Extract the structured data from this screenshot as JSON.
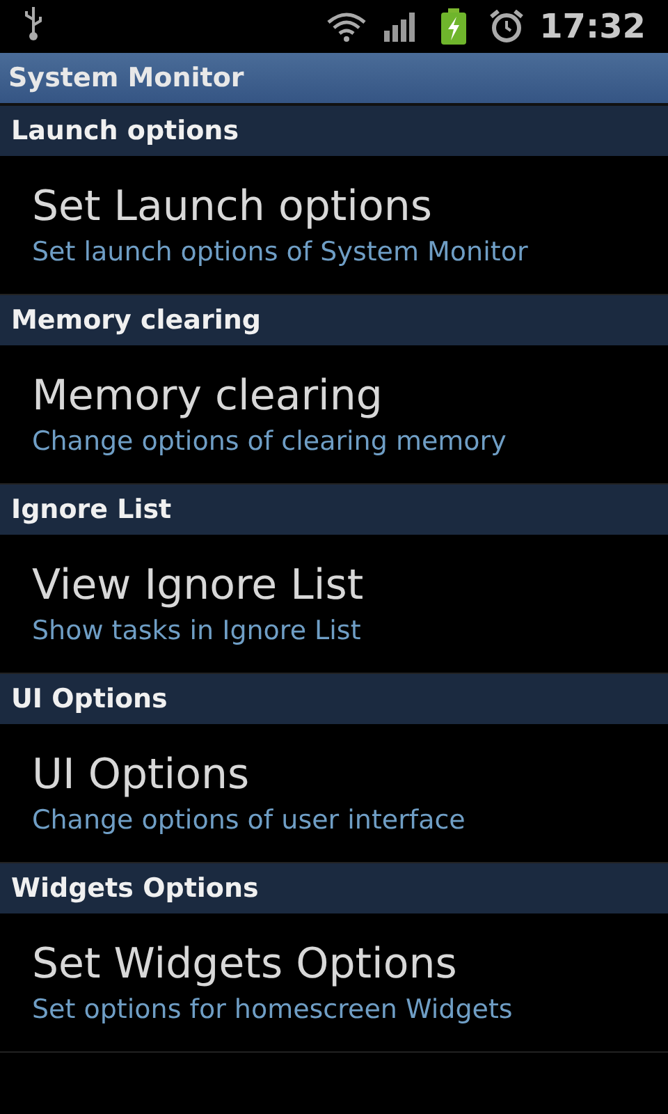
{
  "status_bar": {
    "time": "17:32"
  },
  "window": {
    "title": "System Monitor"
  },
  "sections": [
    {
      "header": "Launch options",
      "title": "Set Launch options",
      "summary": "Set launch options of System Monitor"
    },
    {
      "header": "Memory clearing",
      "title": "Memory clearing",
      "summary": "Change options of clearing memory"
    },
    {
      "header": "Ignore List",
      "title": "View Ignore List",
      "summary": "Show tasks in Ignore List"
    },
    {
      "header": "UI Options",
      "title": "UI Options",
      "summary": "Change options of user interface"
    },
    {
      "header": "Widgets Options",
      "title": "Set Widgets Options",
      "summary": "Set options for homescreen Widgets"
    }
  ]
}
